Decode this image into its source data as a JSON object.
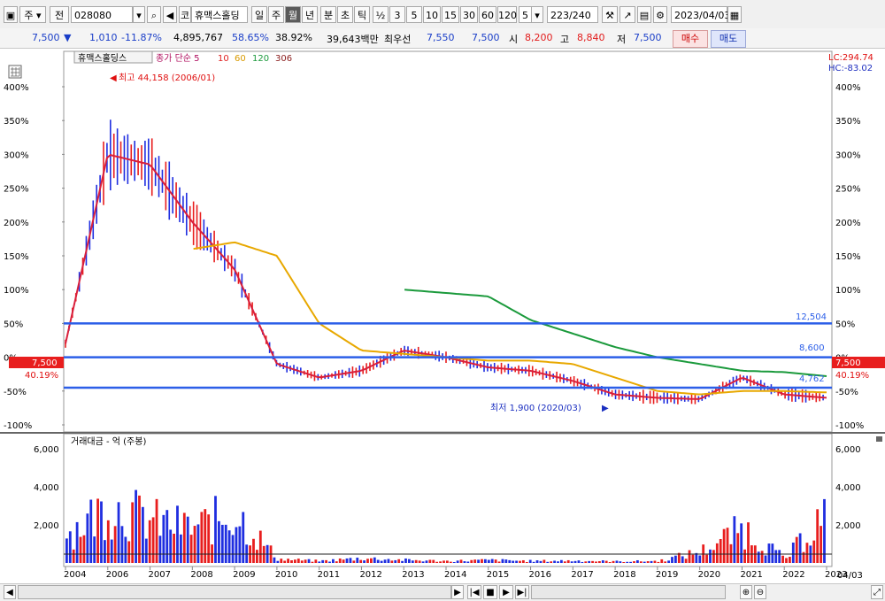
{
  "toolbar": {
    "market_type": "주",
    "prefix": "전",
    "code": "028080",
    "stock_name": "휴맥스홀딩",
    "market_badge": "코",
    "periods": [
      "일",
      "주",
      "월",
      "년",
      "분",
      "초",
      "틱"
    ],
    "active_period": "월",
    "fraction": "½",
    "intervals": [
      "3",
      "5",
      "10",
      "15",
      "30",
      "60",
      "120"
    ],
    "count": "5",
    "page_info": "223/240",
    "date": "2023/04/03"
  },
  "infobar": {
    "price": "7,500",
    "change": "1,010",
    "change_pct": "-11.87%",
    "volume": "4,895,767",
    "rate1": "58.65%",
    "rate2": "38.92%",
    "amount": "39,643백만",
    "priority_label": "최우선",
    "bid": "7,550",
    "ask": "7,500",
    "open_label": "시",
    "open": "8,200",
    "high_label": "고",
    "high": "8,840",
    "low_label": "저",
    "low": "7,500",
    "buy": "매수",
    "sell": "매도"
  },
  "chart": {
    "legend_name": "휴맥스홀딩스",
    "legend_ma": "종가 단순 5",
    "legend_periods": [
      "10",
      "60",
      "120",
      "306"
    ],
    "lc_label": "LC:294.74",
    "hc_label": "HC:-83.02",
    "high_note": "최고 44,158 (2006/01)",
    "low_note": "최저 1,900 (2020/03)",
    "hline_values": [
      "12,504",
      "8,600",
      "4,762"
    ],
    "current_price": "7,500",
    "current_pct": "40.19%",
    "vol_title": "거래대금 - 억 (주봉)",
    "date_stamp": "04/03",
    "colors": {
      "up": "#e81e1e",
      "down": "#1f2ee0",
      "ma5": "#d91f3b",
      "ma10": "#e8b400",
      "ma60": "#e8a800",
      "ma120": "#1b9a3c",
      "hline": "#2c5fe8"
    }
  },
  "chart_data": {
    "type": "line",
    "x": [
      "2004",
      "2006",
      "2007",
      "2008",
      "2009",
      "2010",
      "2011",
      "2012",
      "2013",
      "2014",
      "2015",
      "2016",
      "2017",
      "2018",
      "2019",
      "2020",
      "2021",
      "2022",
      "2023"
    ],
    "price_axis_pct": [
      "400%",
      "350%",
      "300%",
      "250%",
      "200%",
      "150%",
      "100%",
      "50%",
      "0%",
      "-50%",
      "-100%"
    ],
    "volume_axis": [
      "6,000",
      "4,000",
      "2,000"
    ],
    "series": [
      {
        "name": "5",
        "values": [
          20,
          300,
          285,
          200,
          130,
          -10,
          -30,
          -20,
          10,
          0,
          -15,
          -20,
          -35,
          -55,
          -60,
          -62,
          -30,
          -55,
          -60
        ]
      },
      {
        "name": "60",
        "values": [
          null,
          null,
          null,
          160,
          170,
          150,
          50,
          10,
          5,
          0,
          -5,
          -5,
          -10,
          -30,
          -50,
          -55,
          -50,
          -50,
          -52
        ]
      },
      {
        "name": "120",
        "values": [
          null,
          null,
          null,
          null,
          null,
          null,
          null,
          null,
          100,
          95,
          90,
          55,
          35,
          15,
          0,
          -10,
          -20,
          -22,
          -28
        ]
      }
    ],
    "volume": [
      1500,
      3000,
      2200,
      1800,
      2600,
      200,
      100,
      250,
      150,
      100,
      150,
      100,
      120,
      80,
      100,
      600,
      1800,
      200,
      2800
    ]
  }
}
